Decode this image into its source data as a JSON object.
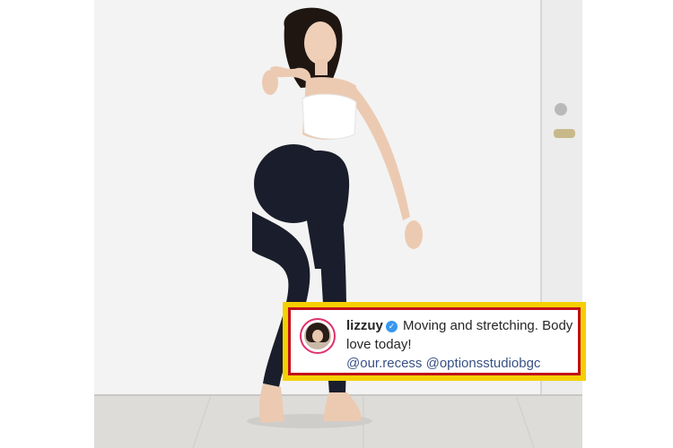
{
  "post": {
    "username": "lizzuy",
    "verified_icon": "verified-badge-icon",
    "caption": "Moving and stretching. Body love today!",
    "mention_1": "@our.recess",
    "mention_2": "@optionsstudiobgc"
  },
  "colors": {
    "frame_red": "#c0101a",
    "frame_yellow": "#f5d000",
    "verified_blue": "#3897f0",
    "mention_blue": "#385185"
  }
}
